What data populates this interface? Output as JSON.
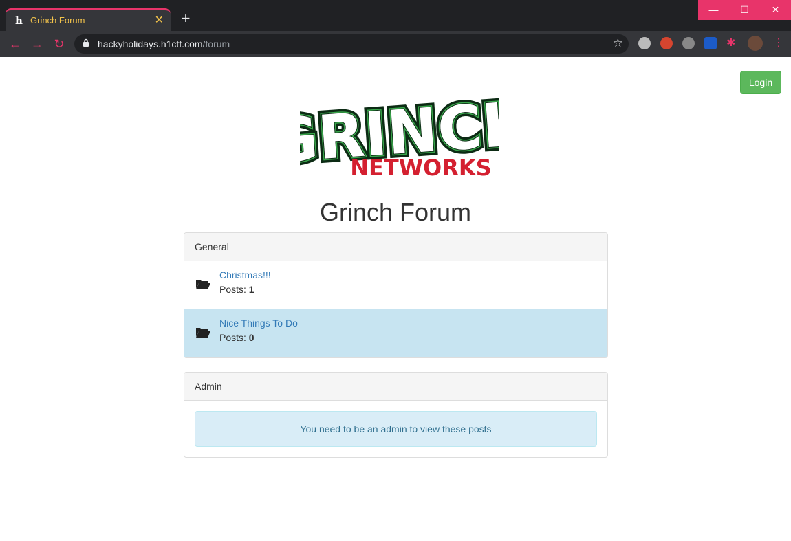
{
  "browser": {
    "tab_title": "Grinch Forum",
    "tab_favicon": "h",
    "url_host": "hackyholidays.h1ctf.com",
    "url_path": "/forum"
  },
  "header": {
    "login_label": "Login",
    "logo_top": "GRINCH",
    "logo_bottom": "NETWORKS"
  },
  "page_title": "Grinch Forum",
  "sections": [
    {
      "title": "General",
      "forums": [
        {
          "name": "Christmas!!!",
          "posts_label": "Posts:",
          "posts": "1"
        },
        {
          "name": "Nice Things To Do",
          "posts_label": "Posts:",
          "posts": "0"
        }
      ]
    },
    {
      "title": "Admin",
      "notice": "You need to be an admin to view these posts"
    }
  ],
  "colors": {
    "accent": "#e8346a",
    "login": "#5cb85c",
    "link": "#337ab7",
    "active_row": "#c7e4f1",
    "alert_bg": "#d9edf7",
    "logo_green": "#3aa64c",
    "logo_red": "#d42030"
  }
}
